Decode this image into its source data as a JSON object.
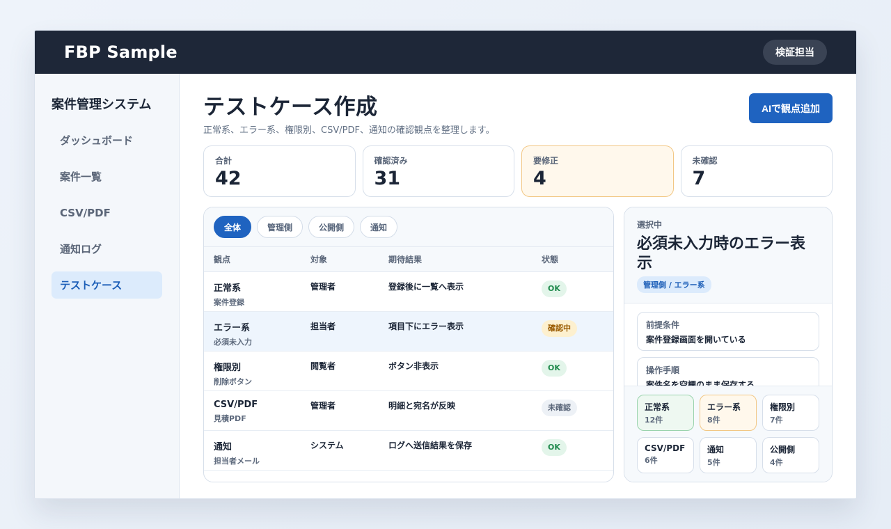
{
  "header": {
    "brand": "FBP Sample",
    "user_label": "検証担当"
  },
  "sidebar": {
    "title": "案件管理システム",
    "items": [
      {
        "label": "ダッシュボード",
        "active": false
      },
      {
        "label": "案件一覧",
        "active": false
      },
      {
        "label": "CSV/PDF",
        "active": false
      },
      {
        "label": "通知ログ",
        "active": false
      },
      {
        "label": "テストケース",
        "active": true
      }
    ]
  },
  "page": {
    "title": "テストケース作成",
    "subtitle": "正常系、エラー系、権限別、CSV/PDF、通知の確認観点を整理します。",
    "ai_button": "AIで観点追加"
  },
  "stats": [
    {
      "label": "合計",
      "value": "42"
    },
    {
      "label": "確認済み",
      "value": "31"
    },
    {
      "label": "要修正",
      "value": "4"
    },
    {
      "label": "未確認",
      "value": "7"
    }
  ],
  "filters": [
    "全体",
    "管理側",
    "公開側",
    "通知"
  ],
  "table": {
    "headers": [
      "観点",
      "対象",
      "期待結果",
      "状態"
    ],
    "rows": [
      {
        "main": "正常系",
        "sub": "案件登録",
        "target": "管理者",
        "expected": "登録後に一覧へ表示",
        "status": "OK"
      },
      {
        "main": "エラー系",
        "sub": "必須未入力",
        "target": "担当者",
        "expected": "項目下にエラー表示",
        "status": "確認中"
      },
      {
        "main": "権限別",
        "sub": "削除ボタン",
        "target": "閲覧者",
        "expected": "ボタン非表示",
        "status": "OK"
      },
      {
        "main": "CSV/PDF",
        "sub": "見積PDF",
        "target": "管理者",
        "expected": "明細と宛名が反映",
        "status": "未確認"
      },
      {
        "main": "通知",
        "sub": "担当者メール",
        "target": "システム",
        "expected": "ログへ送信結果を保存",
        "status": "OK"
      }
    ]
  },
  "detail": {
    "caption": "選択中",
    "title": "必須未入力時のエラー表示",
    "tag": "管理側 / エラー系",
    "precondition_label": "前提条件",
    "precondition_value": "案件登録画面を開いている",
    "steps_label": "操作手順",
    "steps_value": "案件名を空欄のまま保存する",
    "categories": [
      {
        "name": "正常系",
        "count": "12件"
      },
      {
        "name": "エラー系",
        "count": "8件"
      },
      {
        "name": "権限別",
        "count": "7件"
      },
      {
        "name": "CSV/PDF",
        "count": "6件"
      },
      {
        "name": "通知",
        "count": "5件"
      },
      {
        "name": "公開側",
        "count": "4件"
      }
    ]
  }
}
